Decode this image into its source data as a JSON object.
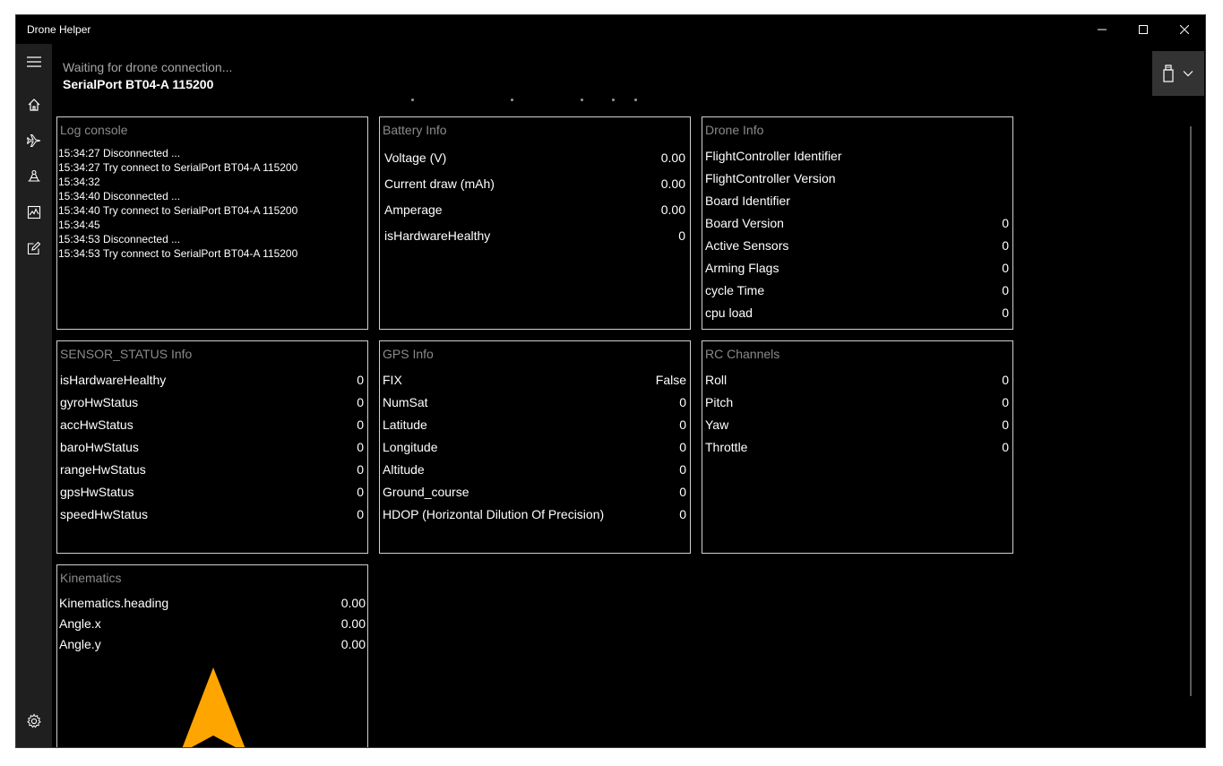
{
  "window": {
    "title": "Drone Helper"
  },
  "header": {
    "status": "Waiting for drone connection...",
    "connection": "SerialPort BT04-A 115200"
  },
  "colors": {
    "accent": "#FFA500",
    "panel_border": "#d0d0d0",
    "background": "#000000"
  },
  "nav": {
    "items": [
      {
        "icon": "hamburger-menu-icon"
      },
      {
        "icon": "home-icon"
      },
      {
        "icon": "airplane-icon"
      },
      {
        "icon": "drone-icon"
      },
      {
        "icon": "chart-icon"
      },
      {
        "icon": "edit-icon"
      },
      {
        "icon": "settings-icon"
      }
    ]
  },
  "log": {
    "title": "Log console",
    "lines": [
      "15:34:27 Disconnected ...",
      "15:34:27 Try connect to SerialPort BT04-A 115200",
      "15:34:32",
      "15:34:40 Disconnected ...",
      "15:34:40 Try connect to SerialPort BT04-A 115200",
      "15:34:45",
      "15:34:53 Disconnected ...",
      "15:34:53 Try connect to SerialPort BT04-A 115200"
    ]
  },
  "battery": {
    "title": "Battery Info",
    "rows": [
      {
        "label": "Voltage (V)",
        "value": "0.00"
      },
      {
        "label": "Current draw (mAh)",
        "value": "0.00"
      },
      {
        "label": "Amperage",
        "value": "0.00"
      },
      {
        "label": "isHardwareHealthy",
        "value": "0"
      }
    ]
  },
  "drone": {
    "title": "Drone Info",
    "rows": [
      {
        "label": "FlightController Identifier",
        "value": ""
      },
      {
        "label": "FlightController Version",
        "value": ""
      },
      {
        "label": "Board Identifier",
        "value": ""
      },
      {
        "label": "Board Version",
        "value": "0"
      },
      {
        "label": "Active Sensors",
        "value": "0"
      },
      {
        "label": "Arming Flags",
        "value": "0"
      },
      {
        "label": "cycle Time",
        "value": "0"
      },
      {
        "label": "cpu load",
        "value": "0"
      }
    ]
  },
  "sensor": {
    "title": "SENSOR_STATUS Info",
    "rows": [
      {
        "label": "isHardwareHealthy",
        "value": "0"
      },
      {
        "label": "gyroHwStatus",
        "value": "0"
      },
      {
        "label": "accHwStatus",
        "value": "0"
      },
      {
        "label": "baroHwStatus",
        "value": "0"
      },
      {
        "label": "rangeHwStatus",
        "value": "0"
      },
      {
        "label": "gpsHwStatus",
        "value": "0"
      },
      {
        "label": "speedHwStatus",
        "value": "0"
      }
    ]
  },
  "gps": {
    "title": "GPS Info",
    "rows": [
      {
        "label": "FIX",
        "value": "False"
      },
      {
        "label": "NumSat",
        "value": "0"
      },
      {
        "label": "Latitude",
        "value": "0"
      },
      {
        "label": "Longitude",
        "value": "0"
      },
      {
        "label": "Altitude",
        "value": "0"
      },
      {
        "label": "Ground_course",
        "value": "0"
      },
      {
        "label": "HDOP (Horizontal Dilution Of Precision)",
        "value": "0"
      }
    ]
  },
  "rc": {
    "title": "RC Channels",
    "rows": [
      {
        "label": "Roll",
        "value": "0"
      },
      {
        "label": "Pitch",
        "value": "0"
      },
      {
        "label": "Yaw",
        "value": "0"
      },
      {
        "label": "Throttle",
        "value": "0"
      }
    ]
  },
  "kinematics": {
    "title": "Kinematics",
    "rows": [
      {
        "label": "Kinematics.heading",
        "value": "0.00"
      },
      {
        "label": "Angle.x",
        "value": "0.00"
      },
      {
        "label": "Angle.y",
        "value": "0.00"
      }
    ],
    "heading_icon": "heading-arrow-icon"
  }
}
